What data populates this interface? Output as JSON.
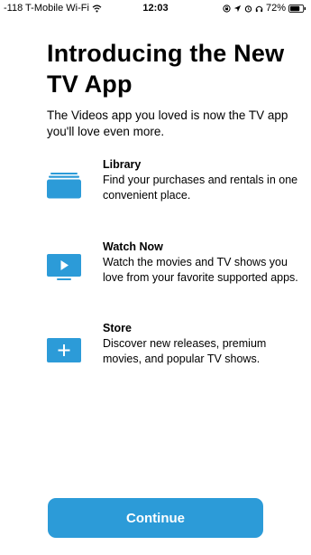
{
  "status_bar": {
    "carrier": "-118 T-Mobile Wi-Fi",
    "time": "12:03",
    "battery": "72%",
    "icons": [
      "wifi-icon",
      "rotation-lock-icon",
      "location-icon",
      "alarm-icon",
      "headphones-icon",
      "battery-icon"
    ]
  },
  "title": "Introducing the New TV App",
  "subtitle": "The Videos app you loved is now the TV app you'll love even more.",
  "features": [
    {
      "icon": "library-stack-icon",
      "heading": "Library",
      "description": "Find your purchases and rentals in one convenient place."
    },
    {
      "icon": "play-screen-icon",
      "heading": "Watch Now",
      "description": "Watch the movies and TV shows you love from your favorite supported apps."
    },
    {
      "icon": "plus-box-icon",
      "heading": "Store",
      "description": "Discover new releases, premium movies, and popular TV shows."
    }
  ],
  "continue_label": "Continue",
  "colors": {
    "accent": "#2c9bd8",
    "text": "#000000",
    "background": "#ffffff"
  }
}
